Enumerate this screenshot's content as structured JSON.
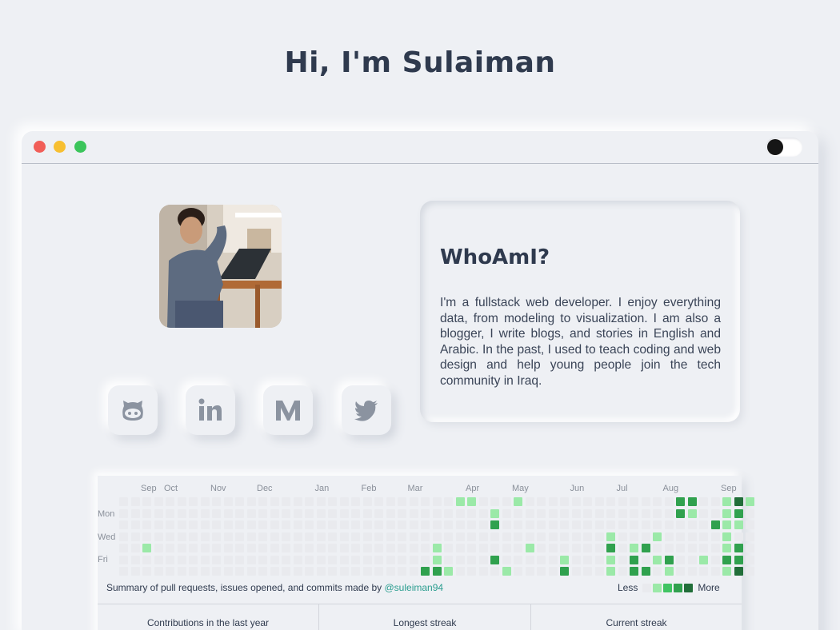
{
  "header": {
    "title": "Hi, I'm Sulaiman"
  },
  "about": {
    "heading": "WhoAmI?",
    "text": "I'm a fullstack web developer. I enjoy everything data, from modeling to visualization. I am also a blogger, I write blogs, and stories in English and Arabic. In the past, I used to teach coding and web design and help young people join the tech community in Iraq."
  },
  "socials": [
    {
      "name": "github",
      "icon": "github-icon"
    },
    {
      "name": "linkedin",
      "icon": "linkedin-icon"
    },
    {
      "name": "medium",
      "icon": "medium-icon"
    },
    {
      "name": "twitter",
      "icon": "twitter-icon"
    }
  ],
  "colors": {
    "empty": "#e9eaee",
    "level1": "#9be9a8",
    "level2": "#40c463",
    "level3": "#30a14e",
    "level4": "#216e39",
    "title": "#2f3a4e"
  },
  "contributions": {
    "months": [
      "Sep",
      "Oct",
      "Nov",
      "Dec",
      "Jan",
      "Feb",
      "Mar",
      "Apr",
      "May",
      "Jun",
      "Jul",
      "Aug",
      "Sep"
    ],
    "days": [
      "Mon",
      "Wed",
      "Fri"
    ],
    "summary_prefix": "Summary of pull requests, issues opened, and commits made by ",
    "handle": "@suleiman94",
    "legend_less": "Less",
    "legend_more": "More",
    "stats": [
      "Contributions in the last year",
      "Longest streak",
      "Current streak"
    ],
    "weeks": [
      [
        0,
        0,
        0,
        0,
        0,
        0,
        0
      ],
      [
        0,
        0,
        0,
        0,
        0,
        0,
        0
      ],
      [
        0,
        0,
        0,
        0,
        1,
        0,
        0
      ],
      [
        0,
        0,
        0,
        0,
        0,
        0,
        0
      ],
      [
        0,
        0,
        0,
        0,
        0,
        0,
        0
      ],
      [
        0,
        0,
        0,
        0,
        0,
        0,
        0
      ],
      [
        0,
        0,
        0,
        0,
        0,
        0,
        0
      ],
      [
        0,
        0,
        0,
        0,
        0,
        0,
        0
      ],
      [
        0,
        0,
        0,
        0,
        0,
        0,
        0
      ],
      [
        0,
        0,
        0,
        0,
        0,
        0,
        0
      ],
      [
        0,
        0,
        0,
        0,
        0,
        0,
        0
      ],
      [
        0,
        0,
        0,
        0,
        0,
        0,
        0
      ],
      [
        0,
        0,
        0,
        0,
        0,
        0,
        0
      ],
      [
        0,
        0,
        0,
        0,
        0,
        0,
        0
      ],
      [
        0,
        0,
        0,
        0,
        0,
        0,
        0
      ],
      [
        0,
        0,
        0,
        0,
        0,
        0,
        0
      ],
      [
        0,
        0,
        0,
        0,
        0,
        0,
        0
      ],
      [
        0,
        0,
        0,
        0,
        0,
        0,
        0
      ],
      [
        0,
        0,
        0,
        0,
        0,
        0,
        0
      ],
      [
        0,
        0,
        0,
        0,
        0,
        0,
        0
      ],
      [
        0,
        0,
        0,
        0,
        0,
        0,
        0
      ],
      [
        0,
        0,
        0,
        0,
        0,
        0,
        0
      ],
      [
        0,
        0,
        0,
        0,
        0,
        0,
        0
      ],
      [
        0,
        0,
        0,
        0,
        0,
        0,
        0
      ],
      [
        0,
        0,
        0,
        0,
        0,
        0,
        0
      ],
      [
        0,
        0,
        0,
        0,
        0,
        0,
        0
      ],
      [
        0,
        0,
        0,
        0,
        0,
        0,
        3
      ],
      [
        0,
        0,
        0,
        0,
        1,
        1,
        3
      ],
      [
        0,
        0,
        0,
        0,
        0,
        0,
        1
      ],
      [
        1,
        0,
        0,
        0,
        0,
        0,
        0
      ],
      [
        1,
        0,
        0,
        0,
        0,
        0,
        0
      ],
      [
        0,
        0,
        0,
        0,
        0,
        0,
        0
      ],
      [
        0,
        1,
        3,
        0,
        0,
        3,
        0
      ],
      [
        0,
        0,
        0,
        0,
        0,
        0,
        1
      ],
      [
        1,
        0,
        0,
        0,
        0,
        0,
        0
      ],
      [
        0,
        0,
        0,
        0,
        1,
        0,
        0
      ],
      [
        0,
        0,
        0,
        0,
        0,
        0,
        0
      ],
      [
        0,
        0,
        0,
        0,
        0,
        0,
        0
      ],
      [
        0,
        0,
        0,
        0,
        0,
        1,
        3
      ],
      [
        0,
        0,
        0,
        0,
        0,
        0,
        0
      ],
      [
        0,
        0,
        0,
        0,
        0,
        0,
        0
      ],
      [
        0,
        0,
        0,
        0,
        0,
        0,
        0
      ],
      [
        0,
        0,
        0,
        1,
        3,
        1,
        1
      ],
      [
        0,
        0,
        0,
        0,
        0,
        0,
        0
      ],
      [
        0,
        0,
        0,
        0,
        1,
        3,
        3
      ],
      [
        0,
        0,
        0,
        0,
        3,
        0,
        3
      ],
      [
        0,
        0,
        0,
        1,
        0,
        1,
        0
      ],
      [
        0,
        0,
        0,
        0,
        0,
        3,
        1
      ],
      [
        3,
        3,
        0,
        0,
        0,
        0,
        0
      ],
      [
        3,
        1,
        0,
        0,
        0,
        0,
        0
      ],
      [
        0,
        0,
        0,
        0,
        0,
        1,
        0
      ],
      [
        0,
        0,
        3,
        0,
        0,
        0,
        0
      ],
      [
        1,
        1,
        1,
        1,
        1,
        3,
        1
      ],
      [
        4,
        3,
        1,
        0,
        3,
        3,
        4
      ],
      [
        1,
        0,
        0,
        0,
        0,
        0,
        0
      ]
    ]
  }
}
